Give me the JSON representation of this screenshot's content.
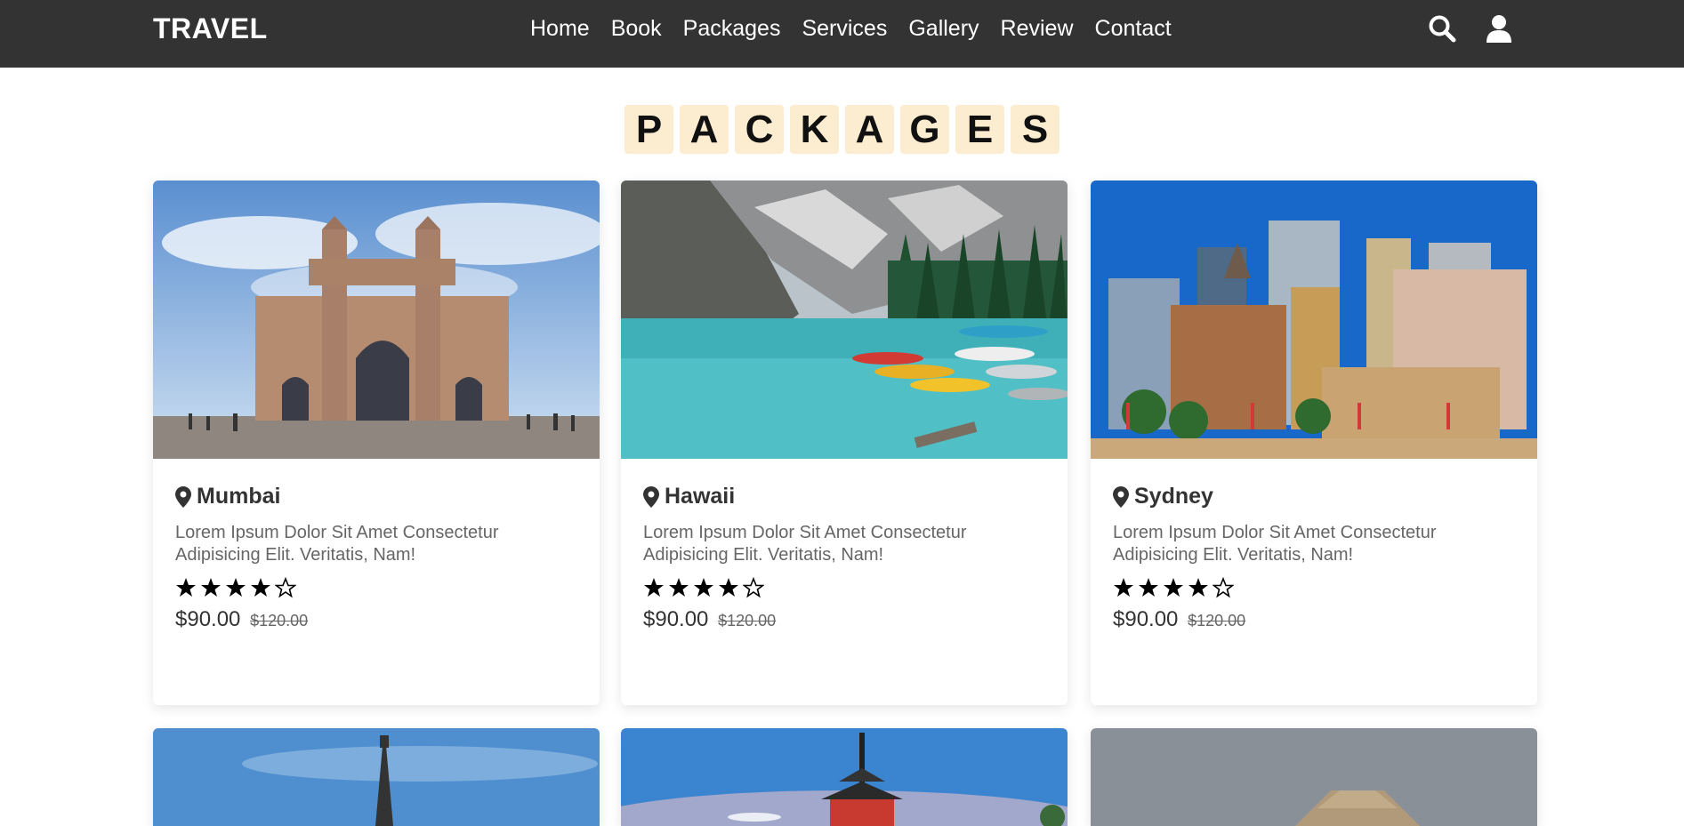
{
  "header": {
    "logo": "TRAVEL",
    "nav": [
      "Home",
      "Book",
      "Packages",
      "Services",
      "Gallery",
      "Review",
      "Contact"
    ],
    "icons": [
      "search-icon",
      "user-icon"
    ]
  },
  "section": {
    "heading_letters": [
      "P",
      "A",
      "C",
      "K",
      "A",
      "G",
      "E",
      "S"
    ]
  },
  "packages": [
    {
      "location": "Mumbai",
      "description": "Lorem Ipsum Dolor Sit Amet Consectetur Adipisicing Elit. Veritatis, Nam!",
      "rating": 4,
      "max_rating": 5,
      "price": "$90.00",
      "old_price": "$120.00"
    },
    {
      "location": "Hawaii",
      "description": "Lorem Ipsum Dolor Sit Amet Consectetur Adipisicing Elit. Veritatis, Nam!",
      "rating": 4,
      "max_rating": 5,
      "price": "$90.00",
      "old_price": "$120.00"
    },
    {
      "location": "Sydney",
      "description": "Lorem Ipsum Dolor Sit Amet Consectetur Adipisicing Elit. Veritatis, Nam!",
      "rating": 4,
      "max_rating": 5,
      "price": "$90.00",
      "old_price": "$120.00"
    }
  ],
  "colors": {
    "header_bg": "#333333",
    "heading_tile": "#fdedd0"
  }
}
